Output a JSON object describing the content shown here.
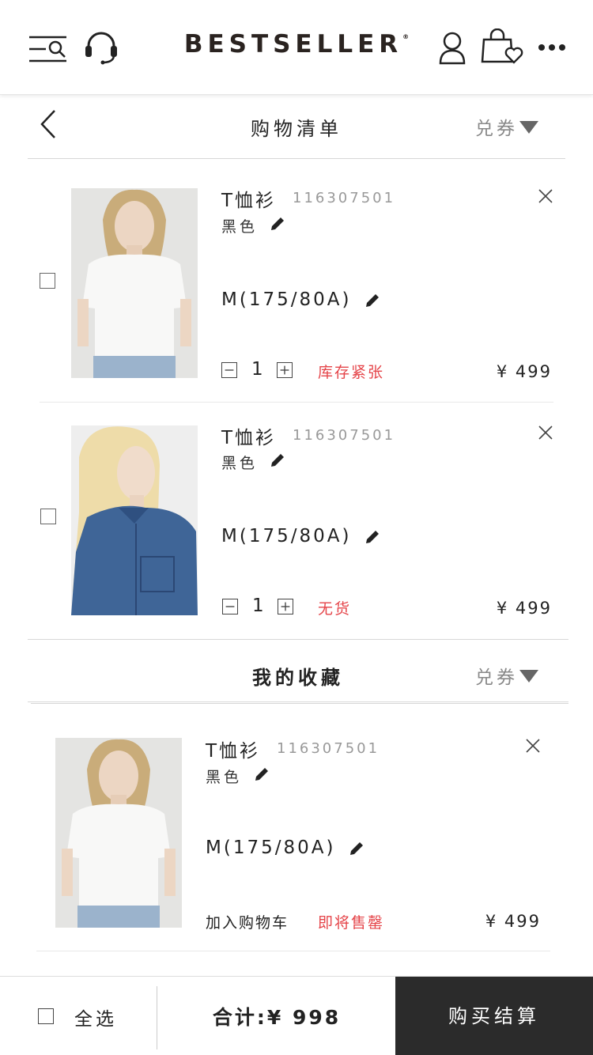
{
  "header": {
    "brand": "BESTSELLER",
    "brand_mark": "®",
    "icons": [
      "menu-search-icon",
      "headset-icon",
      "user-icon",
      "bag-heart-icon",
      "more-icon"
    ]
  },
  "cart": {
    "title": "购物清单",
    "coupon_label": "兑券",
    "items": [
      {
        "name": "T恤衫",
        "code": "116307501",
        "color": "黑色",
        "size": "M(175/80A)",
        "qty": "1",
        "status": "库存紧张",
        "price": "¥ 499"
      },
      {
        "name": "T恤衫",
        "code": "116307501",
        "color": "黑色",
        "size": "M(175/80A)",
        "qty": "1",
        "status": "无货",
        "price": "¥ 499"
      }
    ]
  },
  "favorites": {
    "title": "我的收藏",
    "coupon_label": "兑券",
    "items": [
      {
        "name": "T恤衫",
        "code": "116307501",
        "color": "黑色",
        "size": "M(175/80A)",
        "add_to_cart": "加入购物车",
        "status": "即将售罄",
        "price": "¥ 499"
      }
    ]
  },
  "footer": {
    "select_all": "全选",
    "total": "合计:¥ 998",
    "checkout": "购买结算"
  },
  "colors": {
    "status_red": "#e5454a",
    "checkout_bg": "#2b2b2b"
  }
}
